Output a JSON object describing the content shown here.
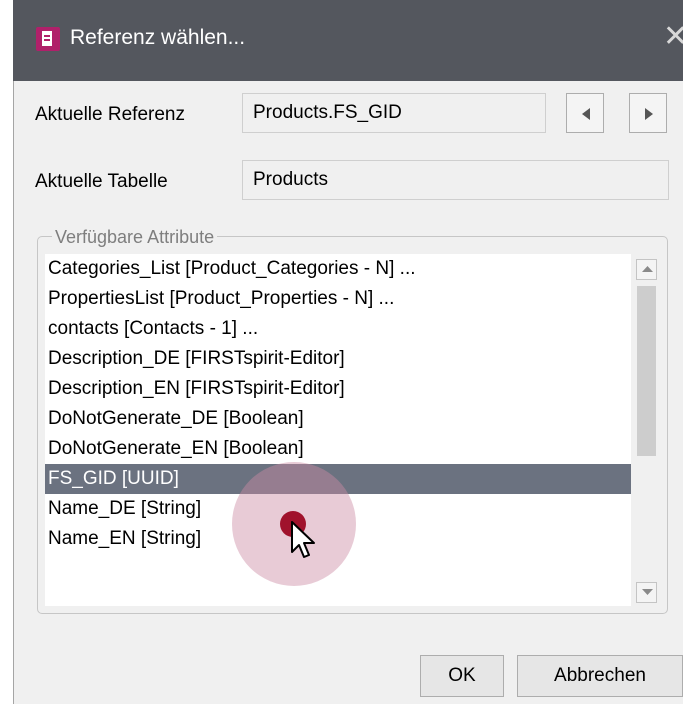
{
  "window": {
    "title": "Referenz wählen...",
    "close_glyph": "✕"
  },
  "current_reference": {
    "label": "Aktuelle Referenz",
    "value": "Products.FS_GID"
  },
  "current_table": {
    "label": "Aktuelle Tabelle",
    "value": "Products"
  },
  "attributes": {
    "legend": "Verfügbare Attribute",
    "items": [
      "Categories_List [Product_Categories - N]  ...",
      "PropertiesList [Product_Properties - N]  ...",
      "contacts [Contacts - 1]  ...",
      "Description_DE [FIRSTspirit-Editor]",
      "Description_EN [FIRSTspirit-Editor]",
      "DoNotGenerate_DE [Boolean]",
      "DoNotGenerate_EN [Boolean]",
      "FS_GID [UUID]",
      "Name_DE [String]",
      "Name_EN [String]"
    ],
    "selected_index": 7
  },
  "buttons": {
    "ok": "OK",
    "cancel": "Abbrechen"
  },
  "icons": {
    "app": "document-icon",
    "prev": "arrow-left-icon",
    "next": "arrow-right-icon",
    "scroll_up": "scroll-up-icon",
    "scroll_down": "scroll-down-icon",
    "cursor": "mouse-cursor-icon"
  },
  "colors": {
    "titlebar": "#54575e",
    "accent": "#b0206a",
    "selection": "#6b7280",
    "click_indicator": "#a0122c"
  }
}
